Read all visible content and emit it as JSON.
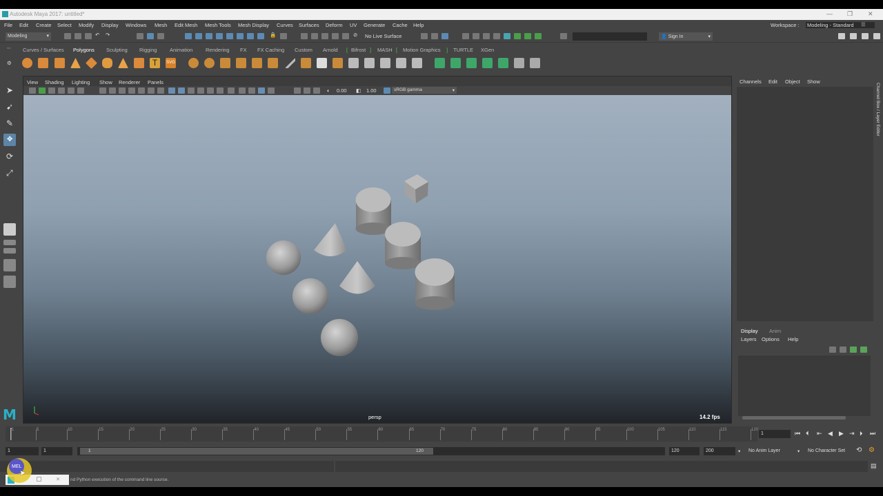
{
  "window": {
    "title": "Autodesk Maya 2017: untitled*"
  },
  "menubar": {
    "items": [
      "File",
      "Edit",
      "Create",
      "Select",
      "Modify",
      "Display",
      "Windows",
      "Mesh",
      "Edit Mesh",
      "Mesh Tools",
      "Mesh Display",
      "Curves",
      "Surfaces",
      "Deform",
      "UV",
      "Generate",
      "Cache",
      "Help"
    ],
    "workspace_label": "Workspace :",
    "workspace_value": "Modeling - Standard"
  },
  "status_line": {
    "menuset": "Modeling",
    "live_surface": "No Live Surface",
    "sign_in": "Sign In"
  },
  "shelf": {
    "tabs": [
      "Curves / Surfaces",
      "Polygons",
      "Sculpting",
      "Rigging",
      "Animation",
      "Rendering",
      "FX",
      "FX Caching",
      "Custom",
      "Arnold",
      "Bifrost",
      "MASH",
      "Motion Graphics",
      "TURTLE",
      "XGen"
    ],
    "active_tab": "Polygons"
  },
  "viewport": {
    "menus": [
      "View",
      "Shading",
      "Lighting",
      "Show",
      "Renderer",
      "Panels"
    ],
    "field_a": "0.00",
    "field_b": "1.00",
    "color_space": "sRGB gamma",
    "camera_label": "persp",
    "fps": "14.2 fps"
  },
  "channel_box": {
    "menus": [
      "Channels",
      "Edit",
      "Object",
      "Show"
    ],
    "side_label": "Channel Box / Layer Editor"
  },
  "layer_editor": {
    "tabs": [
      "Display",
      "Anim"
    ],
    "menus": [
      "Layers",
      "Options",
      "Help"
    ]
  },
  "time_slider": {
    "ticks": [
      "1",
      "5",
      "10",
      "15",
      "20",
      "25",
      "30",
      "35",
      "40",
      "45",
      "50",
      "55",
      "60",
      "65",
      "70",
      "75",
      "80",
      "85",
      "90",
      "95",
      "100",
      "105",
      "110",
      "115",
      "120"
    ],
    "current_frame": "1"
  },
  "range_slider": {
    "start": "1",
    "playback_start": "1",
    "range_start_label": "1",
    "range_end_label": "120",
    "playback_end": "120",
    "end": "200",
    "anim_layer": "No Anim Layer",
    "character_set": "No Character Set"
  },
  "command_line": {
    "language": "MEL"
  },
  "help_line": {
    "text": "nd Python execution of the command line source."
  }
}
